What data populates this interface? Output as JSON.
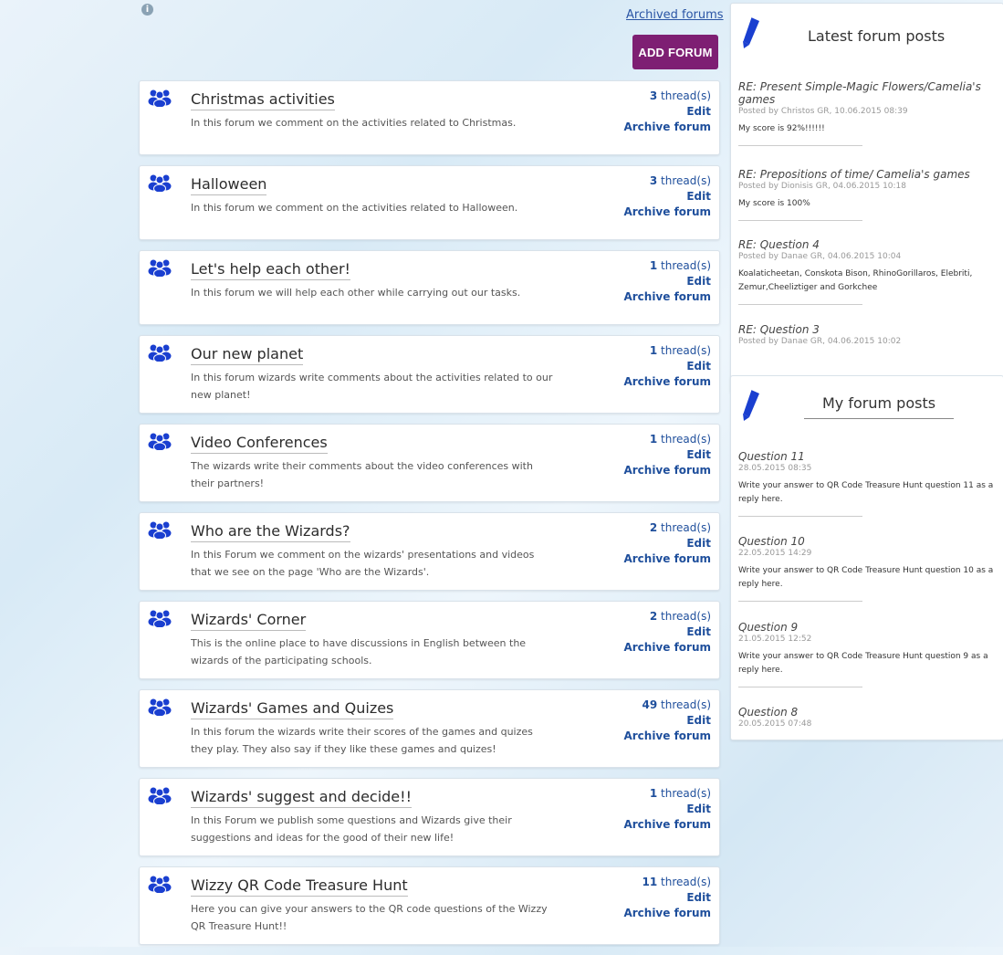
{
  "top": {
    "info_glyph": "i",
    "archived_label": "Archived forums",
    "add_forum_label": "ADD FORUM"
  },
  "forums": [
    {
      "title": "Christmas activities",
      "desc": "In this forum we comment on the activities related to Christmas.",
      "count": "3",
      "threads_suffix": " thread(s)",
      "edit": "Edit",
      "archive": "Archive forum"
    },
    {
      "title": "Halloween",
      "desc": "In this forum we comment on the activities related to Halloween.",
      "count": "3",
      "threads_suffix": " thread(s)",
      "edit": "Edit",
      "archive": "Archive forum"
    },
    {
      "title": "Let's help each other!",
      "desc": "In this forum we will help each other while carrying out our tasks.",
      "count": "1",
      "threads_suffix": " thread(s)",
      "edit": "Edit",
      "archive": "Archive forum"
    },
    {
      "title": "Our new planet",
      "desc": "In this forum wizards write comments about the activities related to our new planet!",
      "count": "1",
      "threads_suffix": " thread(s)",
      "edit": "Edit",
      "archive": "Archive forum"
    },
    {
      "title": "Video Conferences",
      "desc": "The wizards write their comments about the video conferences with their partners!",
      "count": "1",
      "threads_suffix": " thread(s)",
      "edit": "Edit",
      "archive": "Archive forum"
    },
    {
      "title": "Who are the Wizards?",
      "desc": "In this Forum we comment on the wizards' presentations and videos that we see on the page 'Who are the Wizards'.",
      "count": "2",
      "threads_suffix": " thread(s)",
      "edit": "Edit",
      "archive": "Archive forum"
    },
    {
      "title": "Wizards' Corner",
      "desc": "This is the online place to have discussions in English between the wizards of the participating schools.",
      "count": "2",
      "threads_suffix": " thread(s)",
      "edit": "Edit",
      "archive": "Archive forum"
    },
    {
      "title": "Wizards' Games and Quizes",
      "desc": "In this forum the wizards write their scores of the games and quizes they play. They also say if they like these games and quizes!",
      "count": "49",
      "threads_suffix": " thread(s)",
      "edit": "Edit",
      "archive": "Archive forum"
    },
    {
      "title": "Wizards' suggest and decide!!",
      "desc": "In this Forum we publish some questions and Wizards give their suggestions and ideas for the good of their new life!",
      "count": "1",
      "threads_suffix": " thread(s)",
      "edit": "Edit",
      "archive": "Archive forum"
    },
    {
      "title": "Wizzy QR Code Treasure Hunt",
      "desc": "Here you can give your answers to the QR code questions of the Wizzy QR Treasure Hunt!!",
      "count": "11",
      "threads_suffix": " thread(s)",
      "edit": "Edit",
      "archive": "Archive forum"
    }
  ],
  "latest": {
    "title": "Latest forum posts",
    "posts": [
      {
        "title": "RE: Present Simple-Magic Flowers/Camelia's games",
        "meta": "Posted by Christos GR, 10.06.2015 08:39",
        "body": "My score is 92%!!!!!!"
      },
      {
        "title": "RE: Prepositions of time/ Camelia's games",
        "meta": "Posted by Dionisis GR, 04.06.2015 10:18",
        "body": "My score is 100%"
      },
      {
        "title": "RE: Question 4",
        "meta": "Posted by Danae GR, 04.06.2015 10:04",
        "body": "Koalaticheetan, Conskota Bison, RhinoGorillaros, Elebriti, Zemur,Cheeliztiger and Gorkchee"
      },
      {
        "title": "RE: Question 3",
        "meta": "Posted by Danae GR, 04.06.2015 10:02",
        "body": ""
      }
    ]
  },
  "mine": {
    "title": "My forum posts",
    "posts": [
      {
        "title": "Question 11",
        "meta": "28.05.2015 08:35",
        "body": "Write your answer to QR Code Treasure Hunt question 11 as a reply here."
      },
      {
        "title": "Question 10",
        "meta": "22.05.2015 14:29",
        "body": "Write your answer to QR Code Treasure Hunt question 10 as a reply here."
      },
      {
        "title": "Question 9",
        "meta": "21.05.2015 12:52",
        "body": "Write your answer to QR Code Treasure Hunt question 9 as a reply here."
      },
      {
        "title": "Question 8",
        "meta": "20.05.2015 07:48",
        "body": ""
      }
    ]
  },
  "colors": {
    "accent_purple": "#7e1f73",
    "link_blue": "#1f4f9c",
    "forum_icon_blue": "#1a3fd0"
  },
  "icons": {
    "forum": "users-group-icon",
    "pencil": "pencil-icon",
    "info": "info-icon"
  }
}
